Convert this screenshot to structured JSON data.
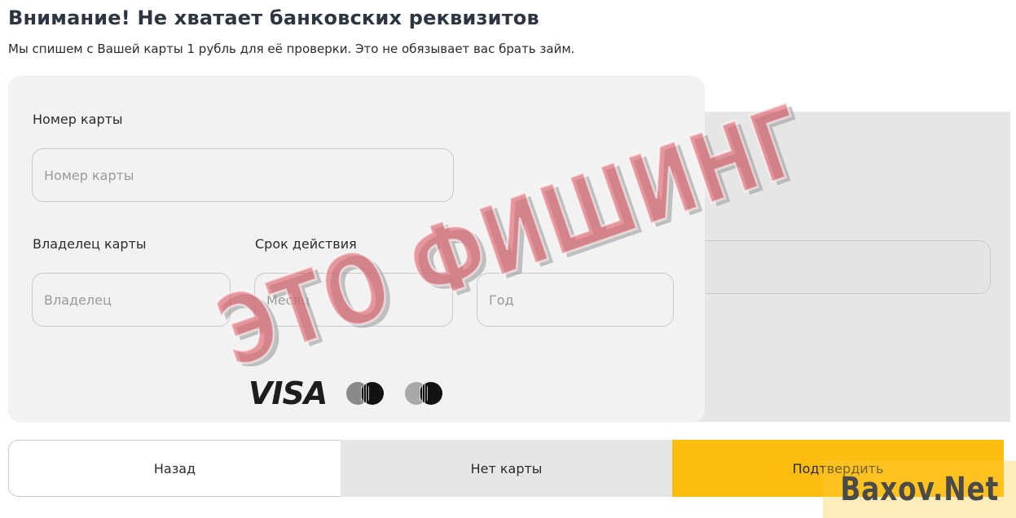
{
  "header": {
    "title": "Внимание! Не хватает банковских реквизитов",
    "subtitle": "Мы спишем с Вашей карты 1 рубль для её проверки. Это не обязывает вас брать займ."
  },
  "card_form": {
    "card_number": {
      "label": "Номер карты",
      "placeholder": "Номер карты",
      "value": ""
    },
    "owner": {
      "label": "Владелец карты",
      "placeholder": "Владелец",
      "value": ""
    },
    "expiry": {
      "label": "Срок действия",
      "month_placeholder": "Месяц",
      "year_placeholder": "Год"
    },
    "brands": [
      "VISA",
      "mastercard",
      "maestro"
    ]
  },
  "buttons": {
    "back": "Назад",
    "no_card": "Нет карты",
    "confirm": "Подтвердить"
  },
  "overlay": {
    "stamp": "ЭТО ФИШИНГ",
    "watermark": "Baxov.Net"
  },
  "colors": {
    "accent": "#fcbd11",
    "card_bg": "#f2f2f2",
    "stamp": "#de5f69"
  }
}
